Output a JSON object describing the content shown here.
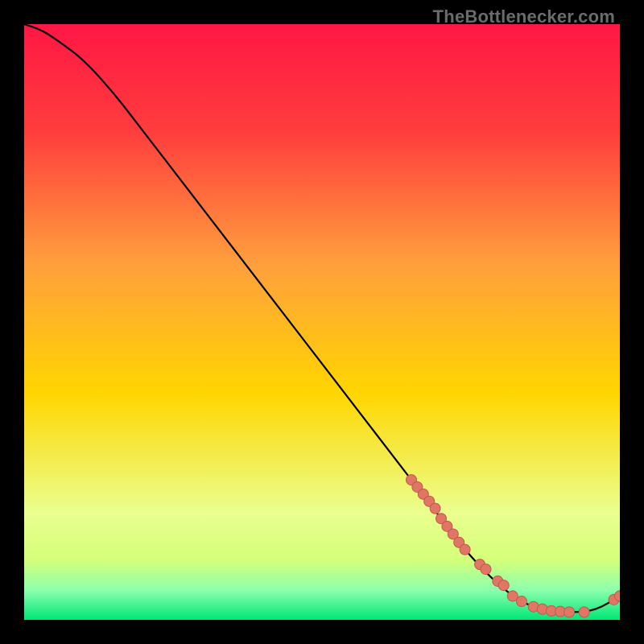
{
  "watermark": "TheBottlenecker.com",
  "colors": {
    "background": "#000000",
    "curve": "#000000",
    "marker_fill": "#e07765",
    "marker_stroke": "#c2584a",
    "gradient_top": "#ff1744",
    "gradient_mid": "#ffd600",
    "gradient_low": "#eaff8f",
    "gradient_bottom": "#00e676"
  },
  "chart_data": {
    "type": "line",
    "title": "",
    "xlabel": "",
    "ylabel": "",
    "xlim": [
      0,
      100
    ],
    "ylim": [
      0,
      100
    ],
    "grid": false,
    "legend": false,
    "series": [
      {
        "name": "bottleneck-curve",
        "x_pct": [
          0,
          3,
          6,
          10,
          15,
          20,
          25,
          30,
          35,
          40,
          45,
          50,
          55,
          60,
          65,
          70,
          73,
          76,
          79,
          82,
          85,
          88,
          91,
          93,
          95,
          97,
          99,
          100
        ],
        "y_pct": [
          100,
          99,
          97,
          94,
          88.5,
          82,
          75.5,
          69,
          62.5,
          56,
          49.5,
          43,
          36.5,
          30,
          23.5,
          17,
          13,
          9.5,
          6.5,
          4,
          2.3,
          1.5,
          1.3,
          1.3,
          1.5,
          2.2,
          3.4,
          4.0
        ]
      }
    ],
    "markers": {
      "name": "highlighted-points",
      "x_pct": [
        65,
        66,
        67,
        68,
        69,
        70,
        71,
        72,
        73,
        74,
        76.5,
        77.5,
        79.5,
        80.5,
        82,
        83.5,
        85.5,
        87,
        88.5,
        90,
        91.5,
        94,
        99,
        100
      ],
      "y_pct": [
        23.5,
        22.3,
        21.1,
        19.9,
        18.7,
        17.0,
        15.7,
        14.4,
        13.0,
        11.8,
        9.3,
        8.5,
        6.5,
        5.8,
        4.0,
        3.1,
        2.2,
        1.8,
        1.5,
        1.4,
        1.3,
        1.3,
        3.4,
        4.0
      ]
    }
  }
}
